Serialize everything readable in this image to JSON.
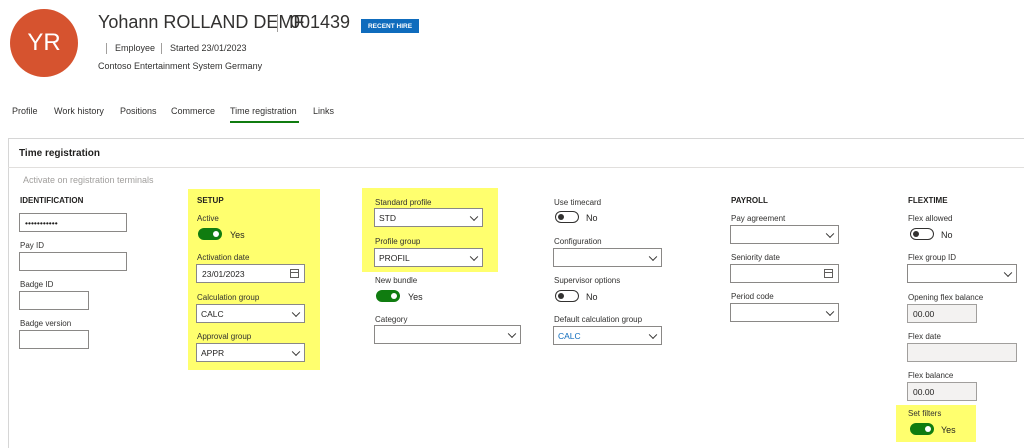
{
  "header": {
    "initials": "YR",
    "name": "Yohann ROLLAND DEMF",
    "number": "001439",
    "badge": "RECENT HIRE",
    "type": "Employee",
    "started": "Started 23/01/2023",
    "company": "Contoso Entertainment System Germany"
  },
  "tabs": [
    "Profile",
    "Work history",
    "Positions",
    "Commerce",
    "Time registration",
    "Links"
  ],
  "section": {
    "title": "Time registration",
    "activate_link": "Activate on registration terminals"
  },
  "identification": {
    "title": "IDENTIFICATION",
    "password": "•••••••••••",
    "pay_id_label": "Pay ID",
    "pay_id": "",
    "badge_id_label": "Badge ID",
    "badge_id": "",
    "badge_version_label": "Badge version",
    "badge_version": ""
  },
  "setup": {
    "title": "SETUP",
    "active_label": "Active",
    "active_value": "Yes",
    "activation_date_label": "Activation date",
    "activation_date": "23/01/2023",
    "calculation_group_label": "Calculation group",
    "calculation_group": "CALC",
    "approval_group_label": "Approval group",
    "approval_group": "APPR"
  },
  "profile": {
    "standard_profile_label": "Standard profile",
    "standard_profile": "STD",
    "profile_group_label": "Profile group",
    "profile_group": "PROFIL",
    "new_bundle_label": "New bundle",
    "new_bundle_value": "Yes",
    "category_label": "Category",
    "category": ""
  },
  "timecard": {
    "use_timecard_label": "Use timecard",
    "use_timecard_value": "No",
    "configuration_label": "Configuration",
    "configuration": "",
    "supervisor_options_label": "Supervisor options",
    "supervisor_options_value": "No",
    "default_calc_group_label": "Default calculation group",
    "default_calc_group": "CALC"
  },
  "payroll": {
    "title": "PAYROLL",
    "pay_agreement_label": "Pay agreement",
    "pay_agreement": "",
    "seniority_date_label": "Seniority date",
    "seniority_date": "",
    "period_code_label": "Period code",
    "period_code": ""
  },
  "flextime": {
    "title": "FLEXTIME",
    "flex_allowed_label": "Flex allowed",
    "flex_allowed_value": "No",
    "flex_group_id_label": "Flex group ID",
    "flex_group_id": "",
    "opening_flex_balance_label": "Opening flex balance",
    "opening_flex_balance": "00.00",
    "flex_date_label": "Flex date",
    "flex_date": "",
    "flex_balance_label": "Flex balance",
    "flex_balance": "00.00",
    "set_filters_label": "Set filters",
    "set_filters_value": "Yes"
  },
  "colors": {
    "avatar": "#d6532f",
    "accent": "#0f6cbd",
    "toggle_on": "#107c10",
    "highlight": "#ffff6e"
  }
}
